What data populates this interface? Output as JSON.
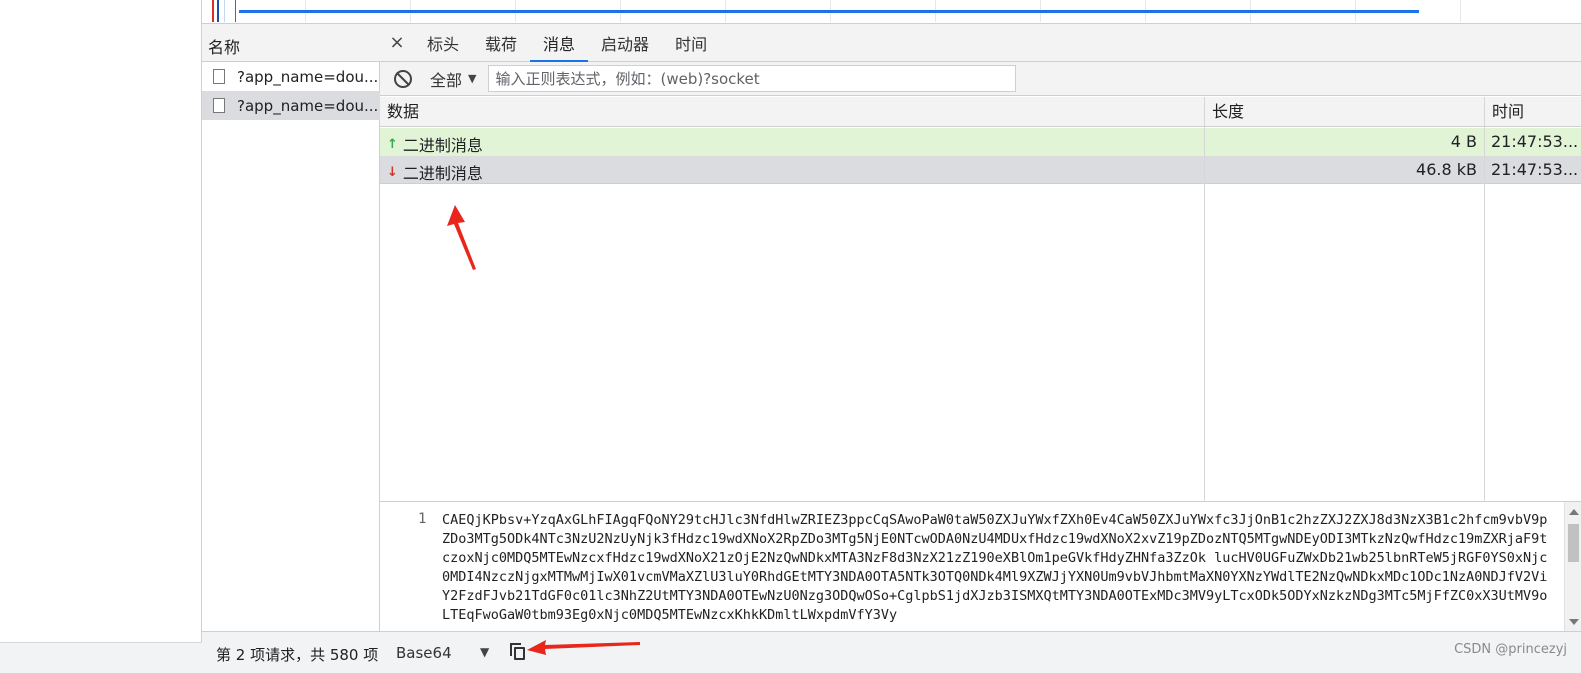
{
  "requests": {
    "column_header": "名称",
    "items": [
      {
        "name": "?app_name=dou..."
      },
      {
        "name": "?app_name=dou..."
      }
    ],
    "status_text": "第 2 项请求，共 580 项"
  },
  "detail": {
    "close_glyph": "×",
    "tabs": [
      {
        "label": "标头"
      },
      {
        "label": "载荷"
      },
      {
        "label": "消息"
      },
      {
        "label": "启动器"
      },
      {
        "label": "时间"
      }
    ],
    "active_tab_index": 2,
    "filter": {
      "select_label": "全部",
      "input_placeholder": "输入正则表达式，例如：(web)?socket"
    },
    "grid": {
      "headers": {
        "data": "数据",
        "length": "长度",
        "time": "时间"
      },
      "rows": [
        {
          "direction": "sent",
          "arrow": "↑",
          "data": "二进制消息",
          "length": "4 B",
          "time": "21:47:53..."
        },
        {
          "direction": "received",
          "arrow": "↓",
          "data": "二进制消息",
          "length": "46.8 kB",
          "time": "21:47:53..."
        }
      ]
    },
    "payload": {
      "line_number": "1",
      "text": "CAEQjKPbsv+YzqAxGLhFIAgqFQoNY29tcHJlc3NfdHlwZRIEZ3ppcCqSAwoPaW0taW50ZXJuYWxfZXh0Ev4CaW50ZXJuYWxfc3JjOnB1c2hzZXJ2ZXJ8d3NzX3B1c2hfcm9vbV9pZDo3MTg5ODk4NTc3NzU2NzUyNjk3fHdzc19wdXNoX2RpZDo3MTg5NjE0NTcwODA0NzU4MDUxfHdzc19wdXNoX2xvZ19pZDozNTQ5MTgwNDEyODI3MTkzNzQwfHdzc19mZXRjaF9tczoxNjc0MDQ5MTEwNzcxfHdzc19wdXNoX21zOjE2NzQwNDkxMTA3NzF8d3NzX21zZ190eXBlOm1peGVkfHdyZHNfa3ZzOk lucHV0UGFuZWxDb21wb25lbnRTeW5jRGF0YS0xNjc0MDI4NzczNjgxMTMwMjIwX01vcmVMaXZlU3luY0RhdGEtMTY3NDA0OTA5NTk3OTQ0NDk4Ml9XZWJjYXN0Um9vbVJhbmtMaXN0YXNzYWdlTE2NzQwNDkxMDc1ODc1NzA0NDJfV2ViY2FzdFJvb21TdGF0c01lc3NhZ2UtMTY3NDA0OTEwNzU0Nzg3ODQwOSo+CglpbS1jdXJzb3ISMXQtMTY3NDA0OTExMDc3MV9yLTcxODk5ODYxNzkzNDg3MTc5MjFfZC0xX3UtMV9oLTEqFwoGaW0tbm93Eg0xNjc0MDQ5MTEwNzcxKhkKDmltLWxpdmVfY3Vy"
    },
    "bottom": {
      "format_label": "Base64",
      "caret": "▼"
    }
  },
  "watermark": "CSDN @princezyj",
  "colors": {
    "accent": "#1a73e8",
    "sent_row_bg": "#e1f5d6",
    "selected_bg": "#dadce0",
    "annotation_red": "#e8261c"
  }
}
